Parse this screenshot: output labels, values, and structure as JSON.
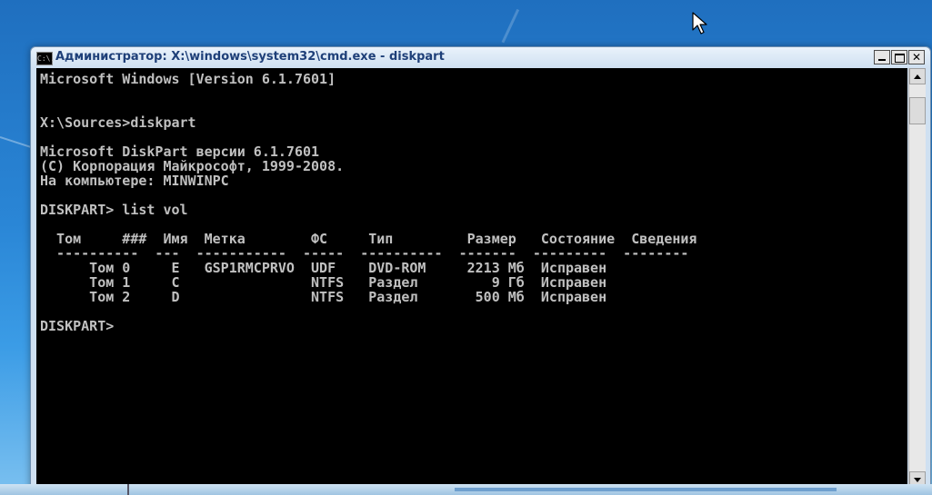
{
  "window": {
    "title": "Администратор: X:\\windows\\system32\\cmd.exe - diskpart",
    "icon_label": "C:\\."
  },
  "console": {
    "lines": [
      "Microsoft Windows [Version 6.1.7601]",
      "",
      "",
      "X:\\Sources>diskpart",
      "",
      "Microsoft DiskPart версии 6.1.7601",
      "(C) Корпорация Майкрософт, 1999-2008.",
      "На компьютере: MINWINPC",
      "",
      "DISKPART> list vol",
      "",
      "  Том     ###  Имя  Метка        ФС     Тип         Размер   Состояние  Сведения",
      "  ----------  ---  -----------  -----  ----------  -------  ---------  --------",
      "      Том 0     E   GSP1RMCPRVO  UDF    DVD-ROM     2213 Мб  Исправен",
      "      Том 1     C                NTFS   Раздел         9 Гб  Исправен",
      "      Том 2     D                NTFS   Раздел       500 Мб  Исправен",
      "",
      "DISKPART>"
    ]
  },
  "colors": {
    "console_bg": "#000000",
    "console_fg": "#c0c0c0",
    "title_text": "#1e3f78"
  },
  "icons": {
    "minimize": "minimize-icon",
    "maximize": "maximize-icon",
    "close": "close-icon",
    "cursor": "arrow-cursor-icon"
  }
}
